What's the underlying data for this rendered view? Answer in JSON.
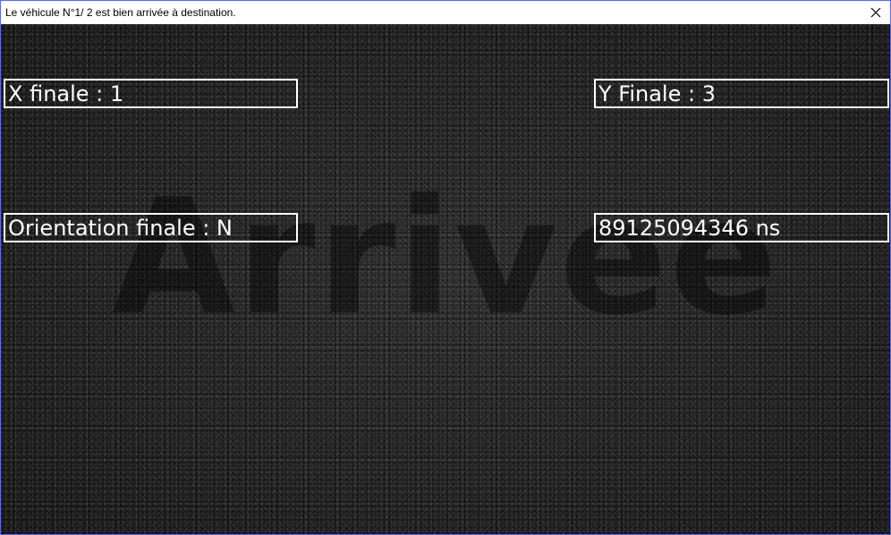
{
  "window": {
    "title": "Le véhicule N°1/ 2 est bien arrivée à destination.",
    "close_icon": "close-icon"
  },
  "content": {
    "watermark": "Arrivee",
    "x_final": "X finale : 1",
    "y_final": "Y Finale : 3",
    "orientation_final": "Orientation finale : N",
    "duration": "89125094346 ns"
  },
  "colors": {
    "text": "#ffffff",
    "box_border": "#ffffff",
    "background": "#2a2a2a",
    "window_border": "#5a6fd6"
  }
}
